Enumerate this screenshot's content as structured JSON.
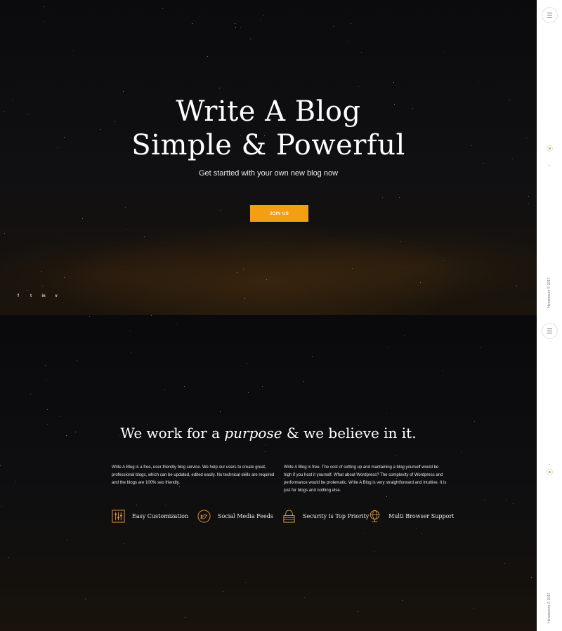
{
  "hero": {
    "title_line1": "Write A Blog",
    "title_line2": "Simple & Powerful",
    "subtitle": "Get startted with your own new blog now",
    "join_label": "JOIN US"
  },
  "social": [
    {
      "name": "facebook-icon",
      "glyph": "f"
    },
    {
      "name": "twitter-icon",
      "glyph": "t"
    },
    {
      "name": "linkedin-icon",
      "glyph": "in"
    },
    {
      "name": "vimeo-icon",
      "glyph": "v"
    }
  ],
  "about": {
    "title_before": "We work for a ",
    "title_em": "purpose",
    "title_after": " & we believe in it.",
    "para1": "Write A Blog is a free, user-friendly blog service. We help our users to create great, professional blogs, which can be updated, edited easily. No technical skills are required and the blogs are 100% seo friendly.",
    "para2": "Write A Blog is free. The cost of setting up and mantaining a blog yourself would be high if you host it yourself. What about Wordpress? The complexity of Wordpress and performance would be prolematic. Write A Blog is very straightforward and intuitive. It is just for blogs and nothing else.",
    "features": [
      {
        "icon": "sliders-icon",
        "label": "Easy Customization"
      },
      {
        "icon": "twitter-circle-icon",
        "label": "Social Media Feeds"
      },
      {
        "icon": "lock-icon",
        "label": "Security Is Top Priority"
      },
      {
        "icon": "globe-icon",
        "label": "Multi Browser Support"
      }
    ]
  },
  "rail": {
    "copyright": "Herozeeum © 2017"
  },
  "colors": {
    "accent": "#f49e12",
    "icon_stroke": "#e7963a",
    "background": "#0a0a0c",
    "rail": "#ffffff"
  }
}
